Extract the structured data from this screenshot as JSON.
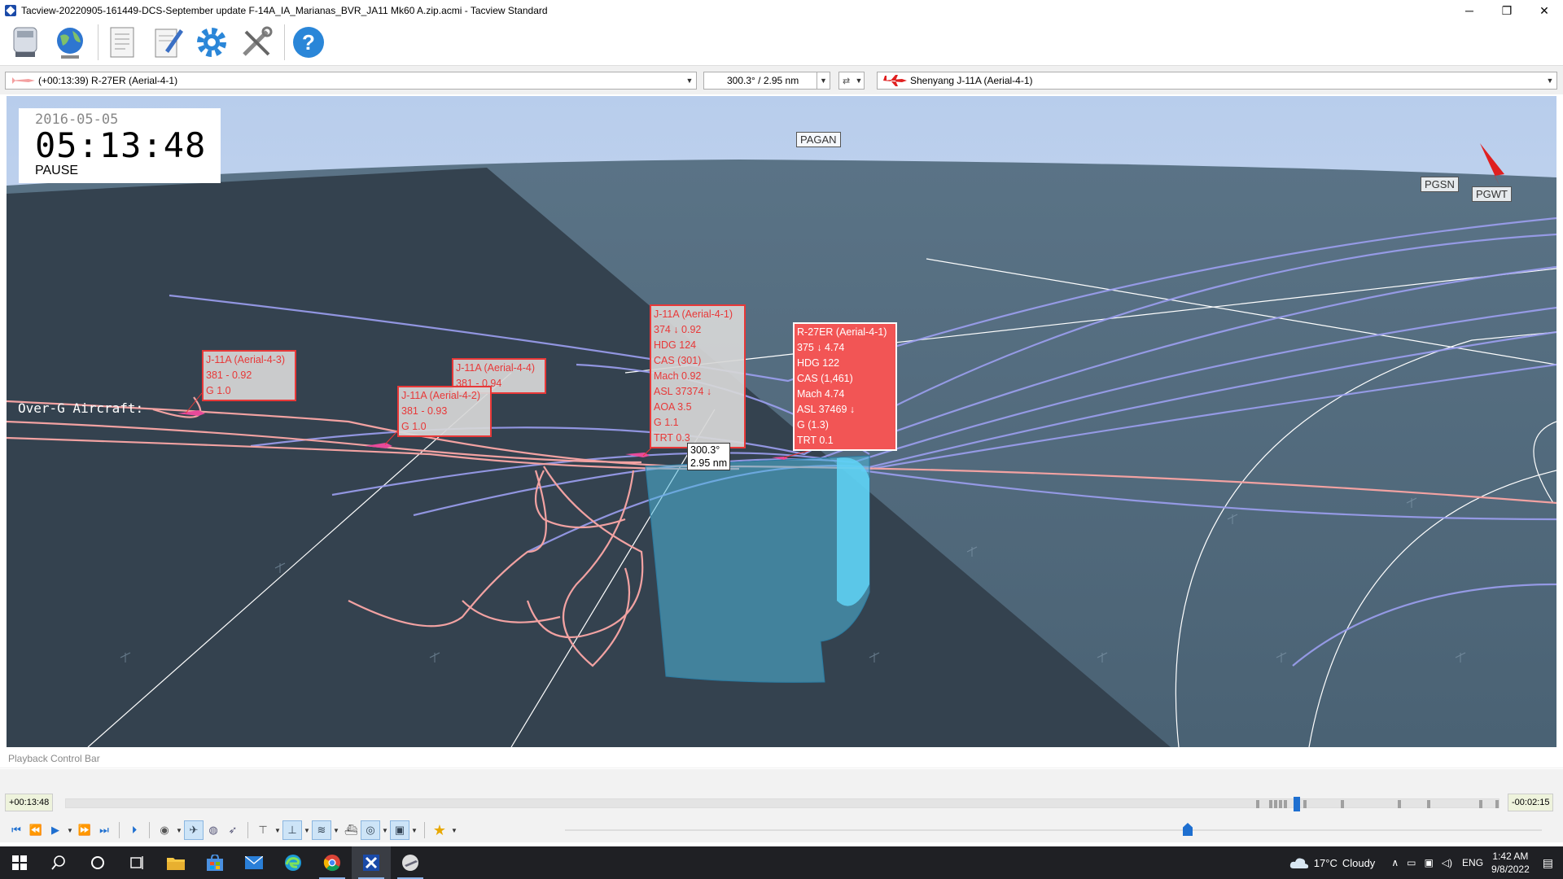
{
  "window": {
    "title": "Tacview-20220905-161449-DCS-September update F-14A_IA_Marianas_BVR_JA11 Mk60 A.zip.acmi - Tacview Standard",
    "min": "─",
    "max": "❐",
    "close": "✕"
  },
  "toolbar": {
    "icons": [
      "recorder-icon",
      "globe-icon",
      "document-icon",
      "notepad-icon",
      "settings-icon",
      "tools-icon",
      "help-icon"
    ]
  },
  "objectbar": {
    "primary_object": "(+00:13:39) R-27ER (Aerial-4-1)",
    "bearing_range": "300.3° / 2.95 nm",
    "secondary_object": "Shenyang J-11A (Aerial-4-1)"
  },
  "viewport": {
    "date": "2016-05-05",
    "time": "05:13:48",
    "state": "PAUSE",
    "places": [
      "PAGAN",
      "PGSN",
      "PGWT"
    ],
    "overg_text": "Over-G Aircraft:",
    "range_label": [
      "300.3°",
      "2.95 nm"
    ],
    "labels": [
      {
        "lines": [
          "J-11A (Aerial-4-3)",
          "381 - 0.92",
          "G 1.0"
        ]
      },
      {
        "lines": [
          "J-11A (Aerial-4-4)",
          "381 - 0.94"
        ]
      },
      {
        "lines": [
          "J-11A (Aerial-4-2)",
          "381 - 0.93",
          "G 1.0"
        ]
      },
      {
        "lines": [
          "J-11A (Aerial-4-1)",
          "374 ↓ 0.92",
          "HDG 124",
          "CAS (301)",
          "Mach 0.92",
          "ASL 37374 ↓",
          "AOA 3.5",
          "G 1.1",
          "TRT 0.3"
        ]
      },
      {
        "lines": [
          "R-27ER (Aerial-4-1)",
          "375 ↓ 4.74",
          "HDG 122",
          "CAS (1,461)",
          "Mach 4.74",
          "ASL 37469 ↓",
          "G (1.3)",
          "TRT 0.1"
        ]
      }
    ],
    "colors": {
      "sky": "#c7d7ef",
      "sea": "#3a4a58",
      "track_red": "#f08a8a",
      "track_blue": "#9aa0f0",
      "label_red": "#e83838",
      "missile_trail": "#3ab8e8"
    }
  },
  "playback": {
    "title": "Playback Control Bar",
    "elapsed": "+00:13:48",
    "remaining": "-00:02:15"
  },
  "taskbar": {
    "weather_temp": "17°C",
    "weather_cond": "Cloudy",
    "lang": "ENG",
    "time": "1:42 AM",
    "date": "9/8/2022"
  }
}
